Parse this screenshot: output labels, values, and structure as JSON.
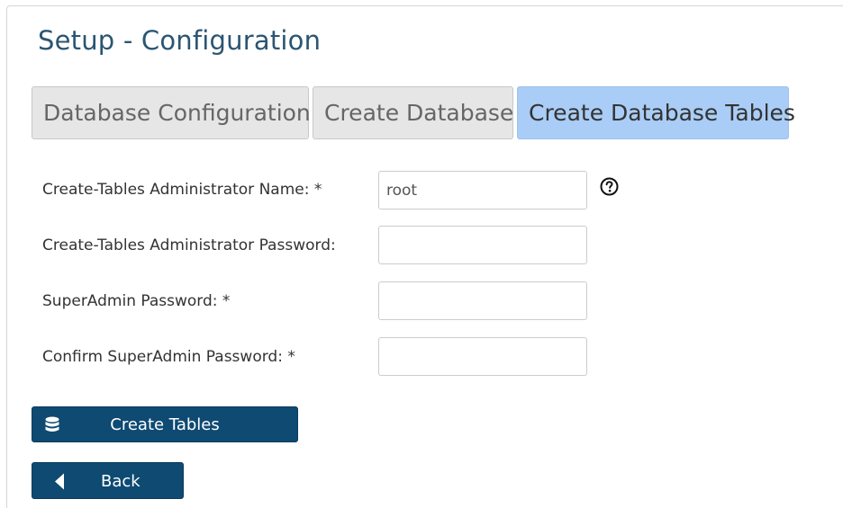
{
  "page": {
    "title": "Setup - Configuration"
  },
  "tabs": [
    {
      "label": "Database Configuration",
      "active": false
    },
    {
      "label": "Create Database",
      "active": false
    },
    {
      "label": "Create Database Tables",
      "active": true
    }
  ],
  "form": {
    "admin_name": {
      "label": "Create-Tables Administrator Name:  *",
      "value": "root",
      "help_icon": "question-circle-icon"
    },
    "admin_password": {
      "label": "Create-Tables Administrator Password:",
      "value": ""
    },
    "superadmin_password": {
      "label": "SuperAdmin Password:  *",
      "value": ""
    },
    "confirm_superadmin_password": {
      "label": "Confirm SuperAdmin Password:  *",
      "value": ""
    }
  },
  "buttons": {
    "create_tables": {
      "label": "Create Tables",
      "icon": "database-icon"
    },
    "back": {
      "label": "Back",
      "icon": "caret-left-icon"
    }
  },
  "colors": {
    "title": "#2b5572",
    "active_tab": "#a9cdf6",
    "inactive_tab": "#e6e6e6",
    "button": "#0e4a72"
  }
}
